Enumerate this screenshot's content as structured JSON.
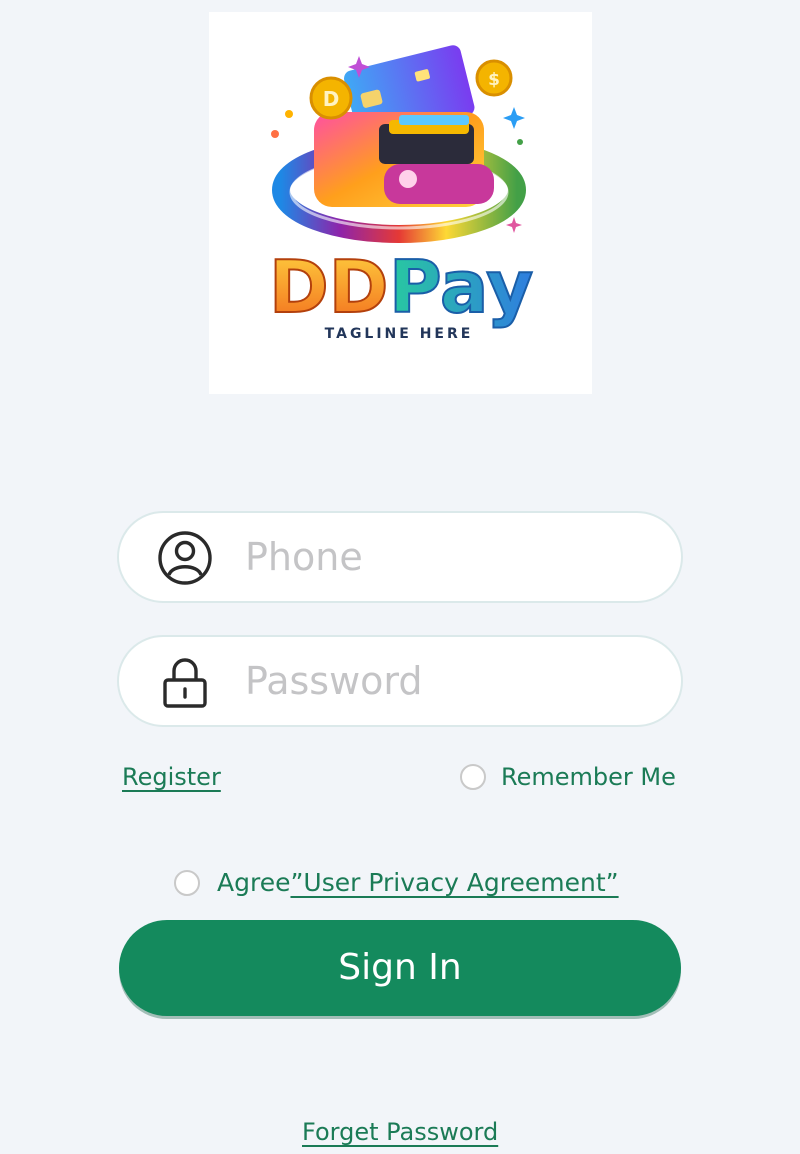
{
  "logo": {
    "brand_first": "DD",
    "brand_second": "Pay",
    "tagline": "TAGLINE HERE",
    "colors": {
      "dd": "#f7a21b",
      "pay": "#2fa8e0",
      "tagline": "#22365a"
    }
  },
  "form": {
    "phone": {
      "placeholder": "Phone",
      "value": "",
      "icon": "user-circle-icon"
    },
    "password": {
      "placeholder": "Password",
      "value": "",
      "icon": "lock-icon"
    }
  },
  "options": {
    "register_label": "Register",
    "remember_label": "Remember Me",
    "remember_checked": false,
    "agree_prefix": "Agree",
    "agree_link": "”User Privacy Agreement”",
    "agree_checked": false
  },
  "actions": {
    "signin_label": "Sign In",
    "forget_label": "Forget Password"
  },
  "theme": {
    "primary": "#148a5d",
    "link": "#1b7b56",
    "background": "#f2f5f9"
  }
}
